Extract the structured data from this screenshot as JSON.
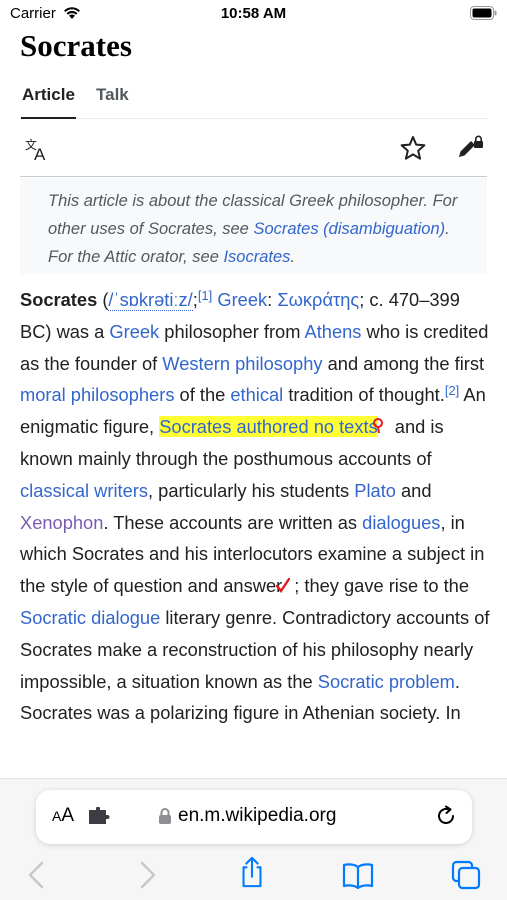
{
  "status_bar": {
    "carrier": "Carrier",
    "time": "10:58 AM",
    "icons": [
      "wifi-icon",
      "battery-icon"
    ]
  },
  "article": {
    "title": "Socrates",
    "tabs": [
      {
        "label": "Article",
        "selected": true
      },
      {
        "label": "Talk",
        "selected": false
      }
    ],
    "toolbar_icons": [
      "translate-icon",
      "star-icon",
      "edit-lock-icon"
    ],
    "hatnote": {
      "t1": "This article is about the classical Greek philosopher. For other uses of Socrates, see ",
      "l1": "Socrates (disambiguation)",
      "t2": ". For the Attic orator, see ",
      "l2": "Isocrates",
      "t3": "."
    },
    "body": {
      "bold_title": "Socrates",
      "p_open": " (",
      "ipa": "/ˈsɒkrətiːz/",
      "semi": ";",
      "ref1": "[1]",
      "greek_label": "Greek",
      "colon": ": ",
      "greek_name": "Σωκράτης",
      "s1": "; c. 470–399 BC) was a ",
      "l_greek": "Greek",
      "s2": " philosopher from ",
      "l_athens": "Athens",
      "s3": " who is credited as the founder of ",
      "l_western": "Western philosophy",
      "s4": " and among the first ",
      "l_moral": "moral philosophers",
      "s5": " of the ",
      "l_ethical": "ethical",
      "s6": " tradition of thought.",
      "ref2": "[2]",
      "s7": " An enigmatic figure, ",
      "highlight": "Socrates authored no texts",
      "s8": " and is known mainly through the posthumous accounts of ",
      "l_classical": "classical writers",
      "s9": ", particularly his students ",
      "l_plato": "Plato",
      "s10": " and ",
      "l_xenophon": "Xenophon",
      "s11": ". These accounts are written as ",
      "l_dialogues": "dialogues",
      "s12": ", in which Socrates and his interlocutors examine a subject in the style of question and answer",
      "s13": "; they gave rise to the ",
      "l_socratic_dialogue": "Socratic dialogue",
      "s14": " literary genre. Contradictory accounts of Socrates make a reconstruction of his philosophy nearly impossible, a situation known as the ",
      "l_socratic_problem": "Socratic problem",
      "s15": ". Socrates was a polarizing figure in Athenian society. In"
    }
  },
  "browser": {
    "aa_small": "A",
    "aa_large": "A",
    "url": "en.m.wikipedia.org",
    "address_icons": [
      "extension-icon",
      "lock-icon",
      "reload-icon"
    ],
    "nav_icons": [
      "back-icon",
      "forward-icon",
      "share-icon",
      "bookmarks-icon",
      "tabs-icon"
    ],
    "colors": {
      "link": "#3366cc",
      "visited": "#795cb2",
      "highlight": "#ffff33",
      "pen": "#e8191c"
    }
  }
}
